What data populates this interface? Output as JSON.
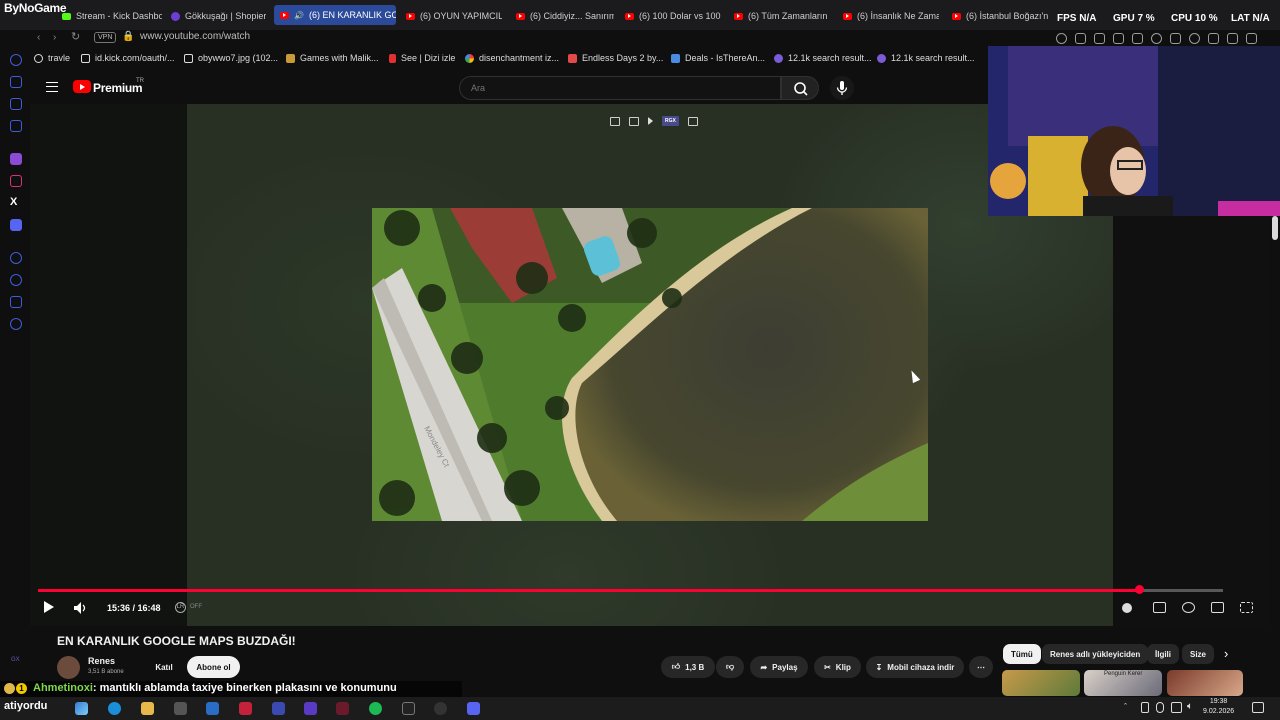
{
  "browser": {
    "brand": "ByNoGame",
    "tabs": [
      {
        "label": "Stream - Kick Dashbo",
        "icon": "kick"
      },
      {
        "label": "Gökkuşağı | Shopier",
        "icon": "shopier"
      },
      {
        "label": "(6) EN KARANLIK GOC",
        "icon": "youtube",
        "active": true
      },
      {
        "label": "(6) OYUN YAPIMCILA",
        "icon": "youtube"
      },
      {
        "label": "(6) Ciddiyiz... Sanırım",
        "icon": "youtube"
      },
      {
        "label": "(6) 100 Dolar vs 100.",
        "icon": "youtube"
      },
      {
        "label": "(6) Tüm Zamanların E",
        "icon": "youtube"
      },
      {
        "label": "(6) İnsanlık Ne Zama",
        "icon": "youtube"
      },
      {
        "label": "(6) İstanbul Boğazı'n",
        "icon": "youtube"
      }
    ],
    "url": "www.youtube.com/watch",
    "vpn_label": "VPN",
    "bookmarks": [
      {
        "label": "travle",
        "color": "#dddddd"
      },
      {
        "label": "id.kick.com/oauth/...",
        "color": "#ffffff"
      },
      {
        "label": "obywwo7.jpg (102...",
        "color": "#ffffff"
      },
      {
        "label": "Games with Malik...",
        "color": "#e8c24a"
      },
      {
        "label": "See | Dizi izle",
        "color": "#ff3b3b"
      },
      {
        "label": "disenchantment iz...",
        "color": "#4285f4"
      },
      {
        "label": "Endless Days 2 by...",
        "color": "#e24a4a"
      },
      {
        "label": "Deals - IsThereAn...",
        "color": "#4a8ce2"
      },
      {
        "label": "12.1k search result...",
        "color": "#7b5cd6"
      },
      {
        "label": "12.1k search result...",
        "color": "#7b5cd6"
      }
    ]
  },
  "overlay_stats": {
    "fps": "FPS N/A",
    "gpu": "GPU 7 %",
    "cpu": "CPU 10 %",
    "lat": "LAT N/A"
  },
  "youtube": {
    "logo_text": "Premium",
    "region": "TR",
    "search_placeholder": "Ara",
    "player": {
      "time": "15:36 / 16:48",
      "progress_fraction": 0.929,
      "lr_label": "LR",
      "lr_state": "OFF",
      "overlay_badge": "RGX"
    },
    "video_title": "EN KARANLIK GOOGLE MAPS BUZDAĞI!",
    "channel": {
      "name": "Renes",
      "subscribers": "3,51 B abone",
      "join_label": "Katıl",
      "subscribe_label": "Abone ol"
    },
    "actions": {
      "likes": "1,3 B",
      "share": "Paylaş",
      "clip": "Klip",
      "download": "Mobil cihaza indir"
    },
    "chips": [
      "Tümü",
      "Renes adlı yükleyiciden",
      "İlgili",
      "Size"
    ],
    "thumb_caption": "Penguin Kerer"
  },
  "map_frame": {
    "street_label": "Mondeley Ct"
  },
  "chat": {
    "user": "Ahmetinoxi",
    "message": ": mantıklı ablamda taxiye binerken plakasını ve konumunu"
  },
  "sidebar_tag": "GX",
  "taskbar": {
    "user": "atiyordu",
    "time": "19:38",
    "date": "9.02.2026"
  }
}
